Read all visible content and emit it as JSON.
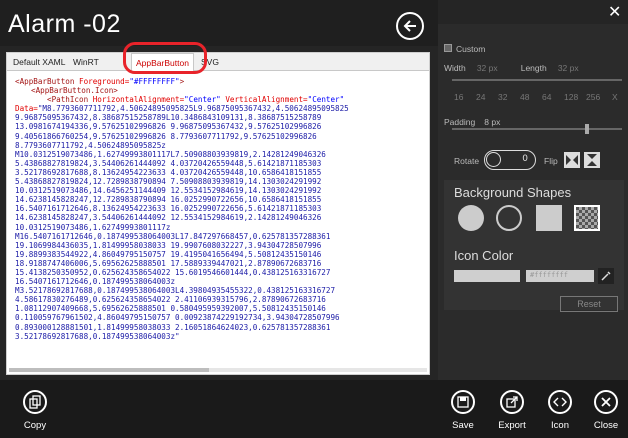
{
  "header": {
    "title": "Alarm -02"
  },
  "tabs": [
    {
      "label": "Default XAML"
    },
    {
      "label": "WinRT AppBar"
    },
    {
      "label": "AppBarButton"
    },
    {
      "label": "SVG"
    }
  ],
  "code": {
    "line1_tag": "<AppBarButton",
    "line1_attr": " Foreground=",
    "line1_val": "\"#FFFFFFFF\"",
    "line1_end": ">",
    "line2": "<AppBarButton.Icon>",
    "line3_tag": "<PathIcon",
    "line3_attr1": " HorizontalAlignment=",
    "line3_val1": "\"Center\"",
    "line3_attr2": " VerticalAlignment=",
    "line3_val2": "\"Center\"",
    "data_label": "Data=",
    "data_lines": [
      "\"M8.7793607711792,4.50624895095825L9.96875095367432,4.50624895095825",
      "9.96875095367432,8.38687515258789L10.3486843109131,8.38687515258789",
      "13.0981674194336,9.57625102996826 9.96875095367432,9.57625102996826",
      "9.40561866760254,9.57625102996826 8.7793607711792,9.57625102996826",
      "8.7793607711792,4.50624895095825z",
      "M10.0312519073486,1.62749993801117L7.50908803939819,2.14281249046326",
      "5.43868827819824,3.54406261444092 4.03720426559448,5.61421871185303",
      "3.52178692817688,8.13624954223633 4.03720426559448,10.6586418151855",
      "5.43868827819824,12.7289838790894 7.50908803939819,14.1303024291992",
      "10.0312519073486,14.6456251144409 12.5534152984619,14.1303024291992",
      "14.6238145828247,12.7289838790894 16.0252990722656,10.6586418151855",
      "16.5407161712646,8.13624954223633 16.0252990722656,5.61421871185303",
      "14.6238145828247,3.54406261444092 12.5534152984619,2.14281249046326",
      "10.0312519073486,1.62749993801117z",
      "M16.5407161712646,0.187499538064003L17.847297668457,0.625781357288361",
      "19.1069984436035,1.81499958038033 19.9907608032227,3.94304728507996",
      "19.8899383544922,4.86049795150757 19.4195041656494,5.50812435150146",
      "18.9188747406006,5.69562625888501 17.5889339447021,2.87890672683716",
      "15.4138250350952,0.625624358654022 15.6019546601444,0.438125163316727",
      "16.5407161712646,0.187499538064003z",
      "M3.52178692817688,0.187499538064003L4.39804935455322,0.438125163316727",
      "4.58617830276489,0.625624358654022 2.41106939315796,2.87890672683716",
      "1.08112907409668,5.69562625888501 0.580495959392007,5.50812435150146",
      "0.110059767961502,4.86049795150757 0.00923874229192734,3.94304728507996",
      "0.893000128881501,1.81499958038033 2.16051864624023,0.625781357288361",
      "3.52178692817688,0.187499538064003z\""
    ]
  },
  "side": {
    "custom_label": "Custom",
    "width_label": "Width",
    "width_value": "32 px",
    "length_label": "Length",
    "length_value": "32 px",
    "sizes": [
      "16",
      "24",
      "32",
      "48",
      "64",
      "128",
      "256",
      "X"
    ],
    "padding_label": "Padding",
    "padding_value": "8 px",
    "padding_level": 0.78,
    "rotate_label": "Rotate",
    "rotate_value": "0",
    "flip_label": "Flip",
    "bg_shapes_label": "Background Shapes",
    "icon_color_label": "Icon Color",
    "icon_color_value": "#ffffffff",
    "reset_label": "Reset"
  },
  "bottom": {
    "copy": "Copy",
    "save": "Save",
    "export": "Export",
    "icon": "Icon",
    "close": "Close"
  },
  "colors": {
    "highlight": "#e8232a",
    "code_blue": "#1a1aa6",
    "tag_red": "#a31515"
  }
}
